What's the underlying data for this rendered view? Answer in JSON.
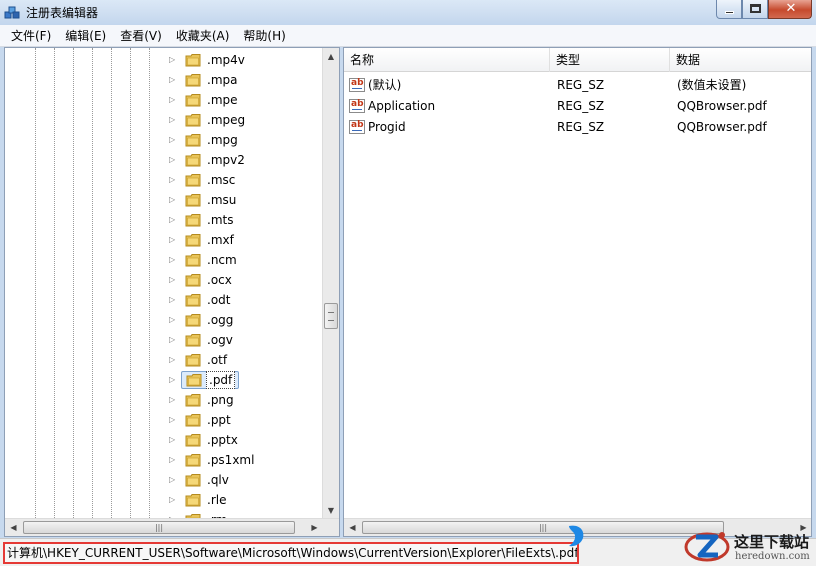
{
  "window": {
    "title": "注册表编辑器"
  },
  "menu": [
    "文件(F)",
    "编辑(E)",
    "查看(V)",
    "收藏夹(A)",
    "帮助(H)"
  ],
  "tree": {
    "items": [
      {
        "label": ".mp4v",
        "selected": false
      },
      {
        "label": ".mpa",
        "selected": false
      },
      {
        "label": ".mpe",
        "selected": false
      },
      {
        "label": ".mpeg",
        "selected": false
      },
      {
        "label": ".mpg",
        "selected": false
      },
      {
        "label": ".mpv2",
        "selected": false
      },
      {
        "label": ".msc",
        "selected": false
      },
      {
        "label": ".msu",
        "selected": false
      },
      {
        "label": ".mts",
        "selected": false
      },
      {
        "label": ".mxf",
        "selected": false
      },
      {
        "label": ".ncm",
        "selected": false
      },
      {
        "label": ".ocx",
        "selected": false
      },
      {
        "label": ".odt",
        "selected": false
      },
      {
        "label": ".ogg",
        "selected": false
      },
      {
        "label": ".ogv",
        "selected": false
      },
      {
        "label": ".otf",
        "selected": false
      },
      {
        "label": ".pdf",
        "selected": true
      },
      {
        "label": ".png",
        "selected": false
      },
      {
        "label": ".ppt",
        "selected": false
      },
      {
        "label": ".pptx",
        "selected": false
      },
      {
        "label": ".ps1xml",
        "selected": false
      },
      {
        "label": ".qlv",
        "selected": false
      },
      {
        "label": ".rle",
        "selected": false
      },
      {
        "label": ".rm",
        "selected": false
      }
    ]
  },
  "values": {
    "columns": [
      "名称",
      "类型",
      "数据"
    ],
    "rows": [
      {
        "name": "(默认)",
        "type": "REG_SZ",
        "data": "(数值未设置)"
      },
      {
        "name": "Application",
        "type": "REG_SZ",
        "data": "QQBrowser.pdf"
      },
      {
        "name": "Progid",
        "type": "REG_SZ",
        "data": "QQBrowser.pdf"
      }
    ]
  },
  "status": {
    "path": "计算机\\HKEY_CURRENT_USER\\Software\\Microsoft\\Windows\\CurrentVersion\\Explorer\\FileExts\\.pdf"
  },
  "watermark": {
    "name": "这里下载站",
    "url": "heredown.com"
  },
  "icons": {
    "app": "regedit-icon",
    "folder": "folder-icon",
    "value": "string-value-icon"
  },
  "colors": {
    "highlight_border": "#e53935",
    "titlebar": "#c7d9ee",
    "close_button": "#c64a2e"
  }
}
